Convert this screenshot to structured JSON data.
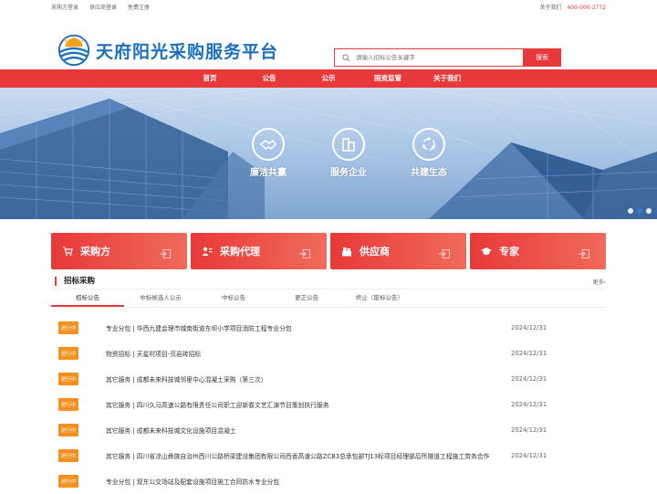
{
  "topbar": {
    "links": [
      "采购方登录",
      "供应商登录",
      "免费注册"
    ],
    "about_label": "关于我们",
    "phone": "400-000-2772"
  },
  "header": {
    "title": "天府阳光采购服务平台",
    "search_placeholder": "请输入招标公告关键字",
    "search_button": "搜索"
  },
  "nav": {
    "items": [
      "首页",
      "公告",
      "公示",
      "国资监管",
      "关于我们"
    ]
  },
  "banner": {
    "features": [
      {
        "label": "廉洁共赢",
        "icon": "handshake-icon"
      },
      {
        "label": "服务企业",
        "icon": "building-icon"
      },
      {
        "label": "共建生态",
        "icon": "cycle-icon"
      }
    ]
  },
  "categories": [
    {
      "label": "采购方",
      "icon": "cart-icon"
    },
    {
      "label": "采购代理",
      "icon": "agent-icon"
    },
    {
      "label": "供应商",
      "icon": "supplier-icon"
    },
    {
      "label": "专家",
      "icon": "mortarboard-icon"
    }
  ],
  "panel": {
    "title": "招标采购",
    "more": "更多›",
    "tabs": [
      "招标公告",
      "中标候选人公示",
      "中标公告",
      "更正公告",
      "终止（废标公告）"
    ],
    "active_tab": 0,
    "rows": [
      {
        "status": "进行中",
        "title": "专业分包 | 华西九建会理市城南街道东坝小学项目消防工程专业分包",
        "date": "2024/12/31"
      },
      {
        "status": "进行中",
        "title": "物资招标 | 天星村项目-页岩砖招标",
        "date": "2024/12/31"
      },
      {
        "status": "进行中",
        "title": "其它服务 | 成都未来科技城邻里中心混凝土采购（第三次）",
        "date": "2024/12/31"
      },
      {
        "status": "进行中",
        "title": "其它服务 | 四川久马高速公路有限责任公司职工迎新春文艺汇演节目策划执行服务",
        "date": "2024/12/31"
      },
      {
        "status": "进行中",
        "title": "其它服务 | 成都未来科技城文化设施项目混凝土",
        "date": "2024/12/31"
      },
      {
        "status": "进行中",
        "title": "其它服务 | 四川省凉山彝族自治州西川公路桥梁建设集团有限公司西香高速公路ZCB3总承包部TJ13标项目经理部后所隧道工程施工劳务合作",
        "date": "2024/12/31"
      },
      {
        "status": "进行中",
        "title": "专业分包 | 现东公交场站及配套设施项目施工合同防水专业分包",
        "date": ""
      }
    ]
  },
  "colors": {
    "primary_red": "#e8393a",
    "brand_blue": "#1a6fbf",
    "status_orange": "#f5901e"
  }
}
